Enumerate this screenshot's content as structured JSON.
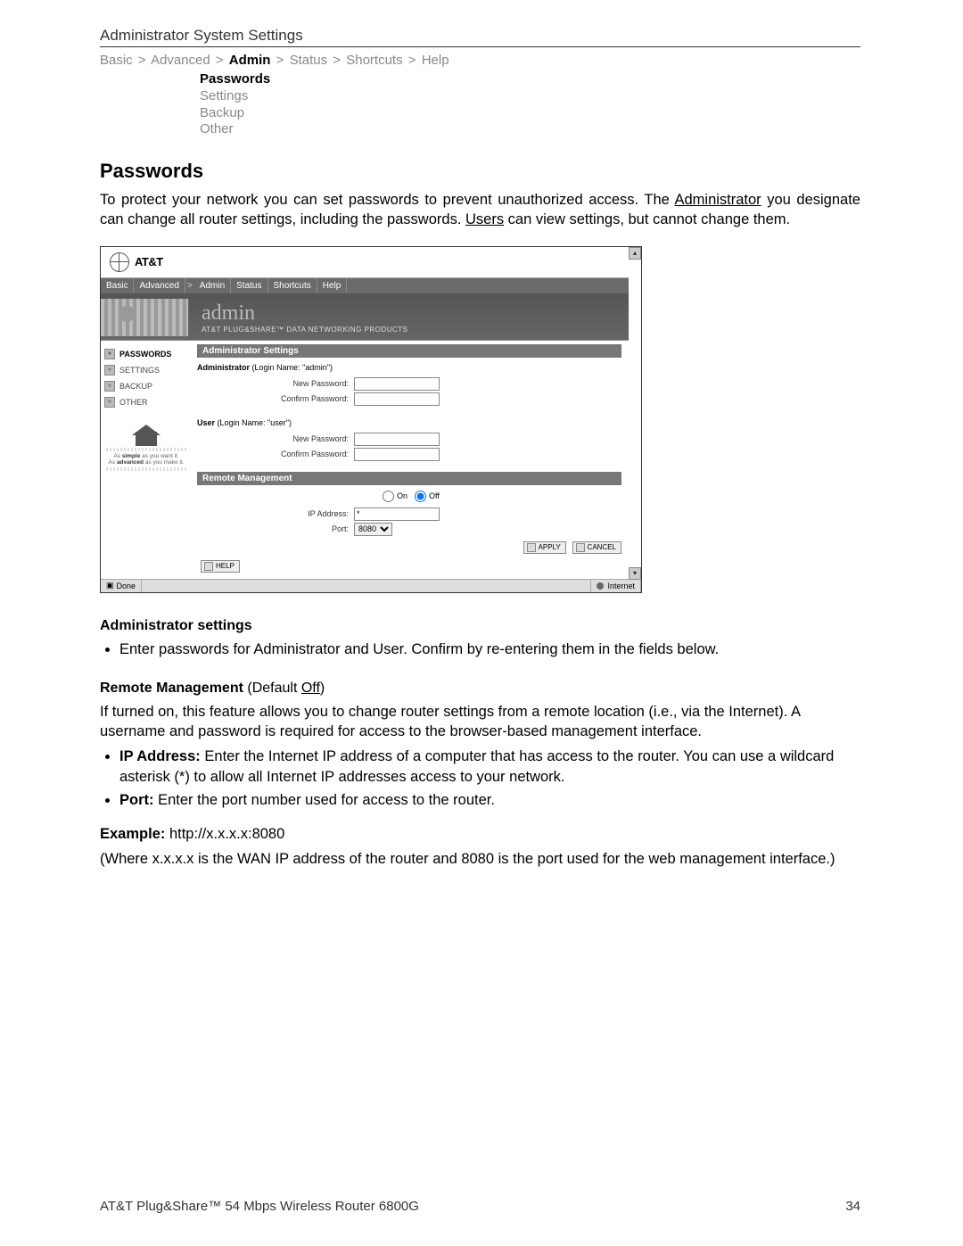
{
  "header": {
    "system_title": "Administrator System Settings",
    "crumbs": [
      "Basic",
      "Advanced",
      "Admin",
      "Status",
      "Shortcuts",
      "Help"
    ],
    "crumbs_active_index": 2,
    "subnav": [
      "Passwords",
      "Settings",
      "Backup",
      "Other"
    ],
    "subnav_active_index": 0
  },
  "section": {
    "title": "Passwords",
    "intro_pre": "To protect your network you can set passwords to prevent unauthorized access. The ",
    "intro_admin": "Administrator",
    "intro_mid": " you designate can change all router settings, including the passwords. ",
    "intro_users": "Users",
    "intro_post": " can view settings, but cannot change them."
  },
  "screenshot": {
    "brand": "AT&T",
    "crumbs": [
      "Basic",
      "Advanced",
      "Admin",
      "Status",
      "Shortcuts",
      "Help"
    ],
    "hero_title": "admin",
    "hero_sub": "AT&T PLUG&SHARE™ DATA NETWORKING PRODUCTS",
    "sidebar": [
      "PASSWORDS",
      "SETTINGS",
      "BACKUP",
      "OTHER"
    ],
    "sidebar_active_index": 0,
    "promo_line1": "As simple as you want it.",
    "promo_line2": "As advanced as you make it.",
    "admin_settings_bar": "Administrator Settings",
    "admin_label": "Administrator",
    "admin_login": " (Login Name: \"admin\")",
    "new_password": "New Password:",
    "confirm_password": "Confirm Password:",
    "user_label": "User",
    "user_login": " (Login Name: \"user\")",
    "remote_bar": "Remote Management",
    "on": "On",
    "off": "Off",
    "ip_label": "IP Address:",
    "ip_value": "*",
    "port_label": "Port:",
    "port_value": "8080",
    "apply": "APPLY",
    "cancel": "CANCEL",
    "help": "HELP",
    "status_done": "Done",
    "status_net": "Internet"
  },
  "admin_settings": {
    "title": "Administrator settings",
    "bullet": "Enter passwords for Administrator and User. Confirm by re-entering them in the fields below."
  },
  "remote": {
    "title": "Remote Management",
    "default_label": " (Default ",
    "default_value": "Off",
    "default_close": ")",
    "desc": "If turned on, this feature allows you to change router settings from a remote location (i.e., via the Internet). A username and password is required for access to the browser-based management interface.",
    "ip_b": "IP Address:",
    "ip_text": " Enter the Internet IP address of a computer that has access to the router. You can use a wildcard asterisk (*) to allow all Internet IP addresses access to your network.",
    "port_b": "Port:",
    "port_text": " Enter the port number used for access to the router.",
    "example_b": "Example:",
    "example_text": " http://x.x.x.x:8080",
    "where": "(Where x.x.x.x is the WAN IP address of the router and 8080 is the port used for the web management interface.)"
  },
  "footer": {
    "product": "AT&T Plug&Share™ 54 Mbps Wireless Router 6800G",
    "page": "34"
  }
}
